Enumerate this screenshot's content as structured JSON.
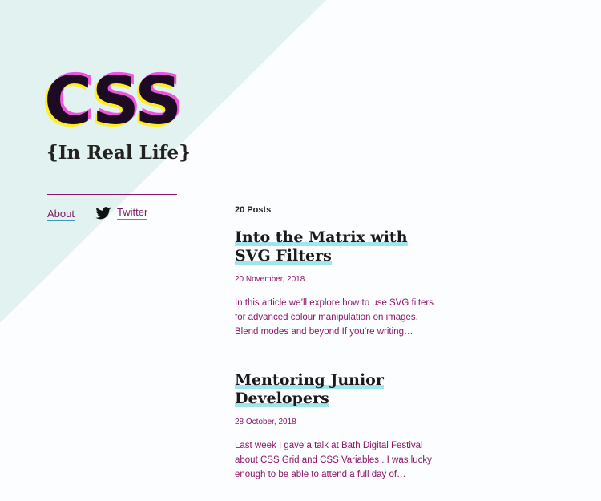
{
  "colors": {
    "background": "#fcfdff",
    "triangle": "#e1f2f0",
    "accent": "#8b1566",
    "highlight": "#9ee6ec",
    "logo_dark": "#1c0b22",
    "logo_pink": "#ee55dd",
    "logo_yellow": "#ffee22"
  },
  "header": {
    "logo_text": "CSS",
    "subtitle": "{In Real Life}"
  },
  "nav": {
    "about_label": "About",
    "twitter_label": "Twitter",
    "twitter_icon": "twitter-bird-icon"
  },
  "main": {
    "post_count": "20 Posts",
    "posts": [
      {
        "title": "Into the Matrix with SVG Filters",
        "date": "20 November, 2018",
        "excerpt": "In this article we’ll explore how to use SVG filters for advanced colour manipulation on images. Blend modes and beyond If you’re writing…"
      },
      {
        "title": "Mentoring Junior Developers",
        "date": "28 October, 2018",
        "excerpt": "Last week I gave a talk at Bath Digital Festival about CSS Grid and CSS Variables . I was lucky enough to be able to attend a full day of…"
      }
    ]
  }
}
